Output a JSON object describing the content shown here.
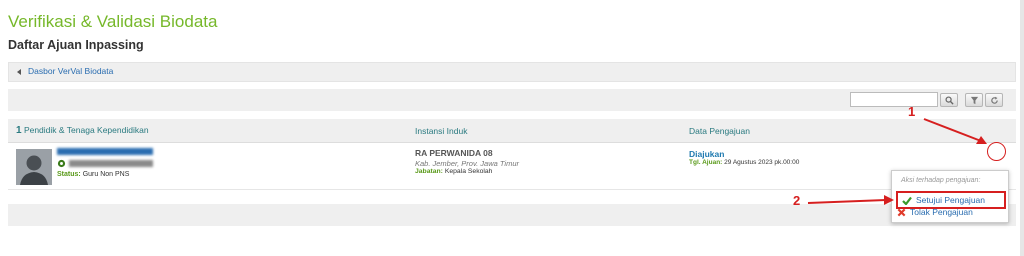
{
  "header": {
    "title": "Verifikasi & Validasi Biodata",
    "subtitle": "Daftar Ajuan Inpassing"
  },
  "breadcrumb": {
    "back_link": "Dasbor VerVal Biodata"
  },
  "toolbar": {
    "search_placeholder": "",
    "search_icon": "magnifier-icon",
    "filter_icon": "funnel-icon",
    "refresh_icon": "refresh-icon"
  },
  "table": {
    "count": "1",
    "columns": [
      "Pendidik & Tenaga Kependidikan",
      "Instansi Induk",
      "Data Pengajuan"
    ],
    "rows": [
      {
        "status_label": "Status:",
        "status_value": "Guru Non PNS",
        "instansi_name": "RA PERWANIDA 08",
        "instansi_location": "Kab. Jember, Prov. Jawa Timur",
        "jabatan_label": "Jabatan:",
        "jabatan_value": "Kepala Sekolah",
        "pengajuan_status": "Diajukan",
        "tgl_label": "Tgl. Ajuan:",
        "tgl_value": "29 Agustus 2023 pk.00:00"
      }
    ]
  },
  "action_menu": {
    "title": "Aksi terhadap pengajuan:",
    "approve_label": "Setujui Pengajuan",
    "reject_label": "Tolak Pengajuan"
  },
  "annotations": {
    "step1": "1",
    "step2": "2",
    "color": "#d61f1f"
  },
  "colors": {
    "title_green": "#76b82a",
    "link_blue": "#2a6db0",
    "header_teal": "#2a7a80",
    "label_green": "#5a9a1a"
  }
}
